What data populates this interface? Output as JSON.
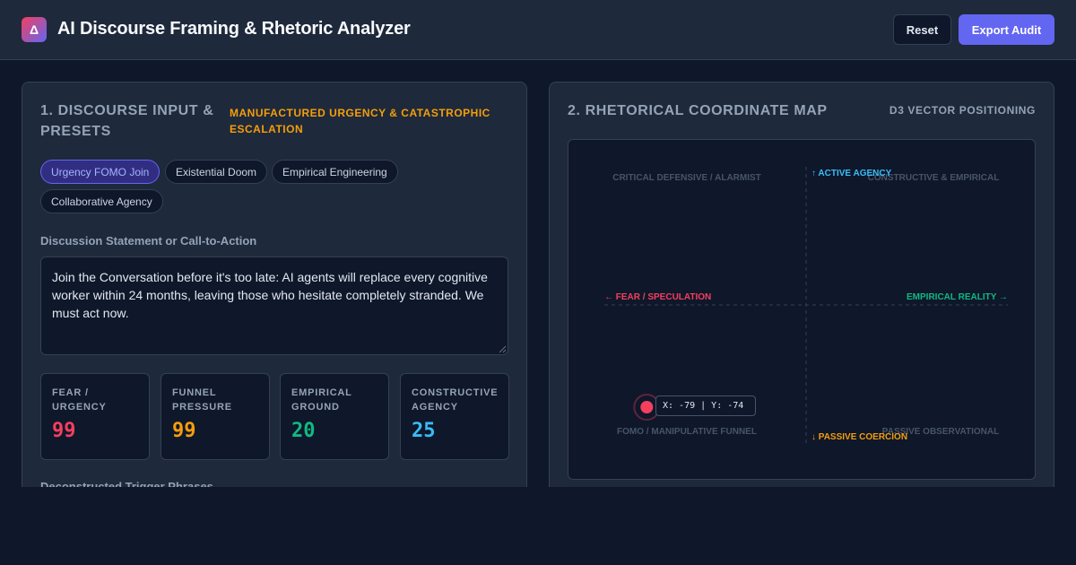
{
  "header": {
    "logo_glyph": "Δ",
    "title": "AI Discourse Framing & Rhetoric Analyzer",
    "reset_label": "Reset",
    "export_label": "Export Audit",
    "accent_color": "#6366f1"
  },
  "input_panel": {
    "title": "1. DISCOURSE INPUT & PRESETS",
    "verdict": "MANUFACTURED URGENCY & CATASTROPHIC ESCALATION",
    "presets": [
      "Urgency FOMO Join",
      "Existential Doom",
      "Empirical Engineering",
      "Collaborative Agency"
    ],
    "active_preset": "Urgency FOMO Join",
    "statement_label": "Discussion Statement or Call-to-Action",
    "statement": "Join the Conversation before it's too late: AI agents will replace every cognitive worker within 24 months, leaving those who hesitate completely stranded. We must act now.",
    "metrics": [
      {
        "label": "FEAR / URGENCY",
        "value": "99",
        "color": "#f43f5e"
      },
      {
        "label": "FUNNEL PRESSURE",
        "value": "99",
        "color": "#f59e0b"
      },
      {
        "label": "EMPIRICAL GROUND",
        "value": "20",
        "color": "#10b981"
      },
      {
        "label": "CONSTRUCTIVE AGENCY",
        "value": "25",
        "color": "#38bdf8"
      }
    ],
    "triggers_label": "Deconstructed Trigger Phrases"
  },
  "map_panel": {
    "title": "2. RHETORICAL COORDINATE MAP",
    "subtitle": "D3 VECTOR POSITIONING",
    "quadrants": {
      "top_left": "CRITICAL DEFENSIVE / ALARMIST",
      "top_right": "CONSTRUCTIVE & EMPIRICAL",
      "bottom_left": "FOMO / MANIPULATIVE FUNNEL",
      "bottom_right": "PASSIVE OBSERVATIONAL"
    },
    "axes": {
      "up": "↑ ACTIVE AGENCY",
      "down": "↓ PASSIVE COERCION",
      "left": "← FEAR / SPECULATION",
      "right": "EMPIRICAL REALITY →"
    },
    "point": {
      "x": -79,
      "y": -74
    },
    "coord_readout": "X: -79 | Y: -74",
    "range": [
      -100,
      100
    ],
    "colors": {
      "up": "#38bdf8",
      "down": "#f59e0b",
      "left": "#f43f5e",
      "right": "#10b981",
      "point": "#f43f5e"
    }
  }
}
